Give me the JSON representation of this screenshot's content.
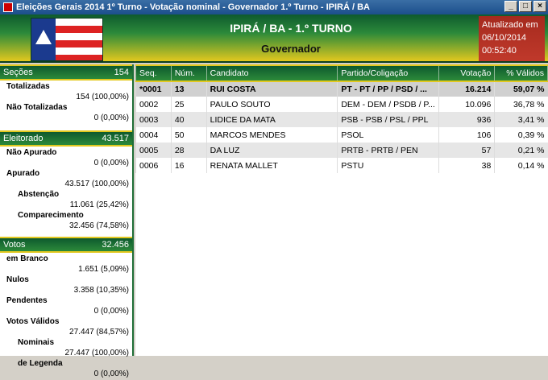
{
  "window": {
    "title": "Eleições Gerais 2014 1º Turno - Votação nominal - Governador 1.º Turno - IPIRÁ / BA"
  },
  "header": {
    "title": "IPIRÁ / BA - 1.º TURNO",
    "subtitle": "Governador"
  },
  "updated": {
    "label": "Atualizado em",
    "date": "06/10/2014",
    "time": "00:52:40"
  },
  "secoes": {
    "label": "Seções",
    "value": "154",
    "totalizadas_label": "Totalizadas",
    "totalizadas_value": "154 (100,00%)",
    "nao_totalizadas_label": "Não Totalizadas",
    "nao_totalizadas_value": "0 (0,00%)"
  },
  "eleitorado": {
    "label": "Eleitorado",
    "value": "43.517",
    "nao_apurado_label": "Não Apurado",
    "nao_apurado_value": "0 (0,00%)",
    "apurado_label": "Apurado",
    "apurado_value": "43.517 (100,00%)",
    "abstencao_label": "Abstenção",
    "abstencao_value": "11.061 (25,42%)",
    "comparecimento_label": "Comparecimento",
    "comparecimento_value": "32.456 (74,58%)"
  },
  "votos": {
    "label": "Votos",
    "value": "32.456",
    "branco_label": "em Branco",
    "branco_value": "1.651 (5,09%)",
    "nulos_label": "Nulos",
    "nulos_value": "3.358 (10,35%)",
    "pendentes_label": "Pendentes",
    "pendentes_value": "0 (0,00%)",
    "validos_label": "Votos Válidos",
    "validos_value": "27.447 (84,57%)",
    "nominais_label": "Nominais",
    "nominais_value": "27.447 (100,00%)",
    "legenda_label": "de Legenda",
    "legenda_value": "0 (0,00%)"
  },
  "table": {
    "headers": {
      "seq": "Seq.",
      "num": "Núm.",
      "candidato": "Candidato",
      "partido": "Partido/Coligação",
      "votacao": "Votação",
      "validos": "% Válidos"
    },
    "rows": [
      {
        "seq": "*0001",
        "num": "13",
        "candidato": "RUI COSTA",
        "partido": "PT - PT / PP / PSD / ...",
        "votacao": "16.214",
        "validos": "59,07 %"
      },
      {
        "seq": "0002",
        "num": "25",
        "candidato": "PAULO SOUTO",
        "partido": "DEM - DEM / PSDB / P...",
        "votacao": "10.096",
        "validos": "36,78 %"
      },
      {
        "seq": "0003",
        "num": "40",
        "candidato": "LIDICE DA MATA",
        "partido": "PSB - PSB / PSL / PPL",
        "votacao": "936",
        "validos": "3,41 %"
      },
      {
        "seq": "0004",
        "num": "50",
        "candidato": "MARCOS MENDES",
        "partido": "PSOL",
        "votacao": "106",
        "validos": "0,39 %"
      },
      {
        "seq": "0005",
        "num": "28",
        "candidato": "DA LUZ",
        "partido": "PRTB - PRTB / PEN",
        "votacao": "57",
        "validos": "0,21 %"
      },
      {
        "seq": "0006",
        "num": "16",
        "candidato": "RENATA MALLET",
        "partido": "PSTU",
        "votacao": "38",
        "validos": "0,14 %"
      }
    ]
  }
}
